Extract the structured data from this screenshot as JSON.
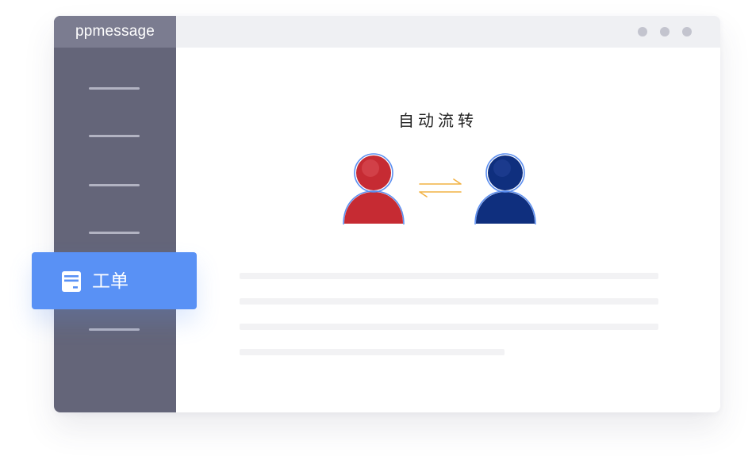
{
  "app": {
    "title": "ppmessage"
  },
  "window_controls": [
    {
      "name": "window-dot-1"
    },
    {
      "name": "window-dot-2"
    },
    {
      "name": "window-dot-3"
    }
  ],
  "sidebar": {
    "active_item": {
      "label": "工单",
      "icon": "ticket-icon"
    }
  },
  "main": {
    "title": "自动流转",
    "transfer": {
      "from_icon": "user-icon-red",
      "to_icon": "user-icon-blue",
      "arrow_icon": "transfer-arrows-icon"
    }
  },
  "colors": {
    "sidebar_bg": "#646579",
    "brand_bg": "#7b7c90",
    "active_bg": "#5991f5",
    "user_red": "#c62b33",
    "user_blue": "#0f2f7e",
    "arrow": "#f2b244"
  }
}
